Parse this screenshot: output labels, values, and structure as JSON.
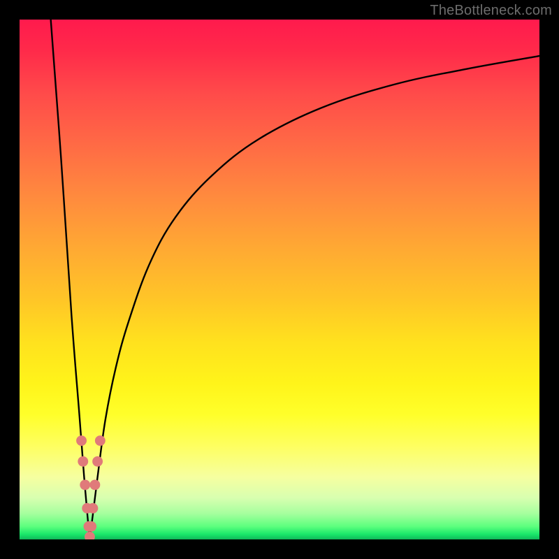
{
  "watermark": "TheBottleneck.com",
  "chart_data": {
    "type": "line",
    "title": "",
    "xlabel": "",
    "ylabel": "",
    "xlim": [
      0,
      100
    ],
    "ylim": [
      0,
      100
    ],
    "grid": false,
    "legend": false,
    "series": [
      {
        "name": "left-branch",
        "x": [
          6,
          8,
          10,
          11.5,
          12.5,
          13.2,
          13.5
        ],
        "y": [
          100,
          73,
          43,
          24,
          11,
          3,
          0
        ]
      },
      {
        "name": "right-branch",
        "x": [
          13.5,
          14,
          15,
          16.5,
          18.5,
          21,
          25,
          30,
          37,
          46,
          58,
          72,
          86,
          100
        ],
        "y": [
          0,
          4,
          12,
          23,
          33,
          42,
          53,
          62,
          70,
          77,
          83,
          87.5,
          90.5,
          93
        ]
      }
    ],
    "points": {
      "name": "beads",
      "coords": [
        {
          "x": 11.9,
          "y": 19
        },
        {
          "x": 12.2,
          "y": 15
        },
        {
          "x": 12.6,
          "y": 10.5
        },
        {
          "x": 13.0,
          "y": 6
        },
        {
          "x": 13.3,
          "y": 2.5
        },
        {
          "x": 13.5,
          "y": 0.5
        },
        {
          "x": 13.8,
          "y": 2.5
        },
        {
          "x": 14.1,
          "y": 6
        },
        {
          "x": 14.5,
          "y": 10.5
        },
        {
          "x": 15.0,
          "y": 15
        },
        {
          "x": 15.5,
          "y": 19
        }
      ],
      "radius_data_units": 1.0
    },
    "gradient_stops_y_to_color": [
      {
        "y": 100,
        "color": "#ff1a4d"
      },
      {
        "y": 50,
        "color": "#ffb030"
      },
      {
        "y": 20,
        "color": "#fff030"
      },
      {
        "y": 3,
        "color": "#40e070"
      },
      {
        "y": 0,
        "color": "#0fb85a"
      }
    ]
  }
}
